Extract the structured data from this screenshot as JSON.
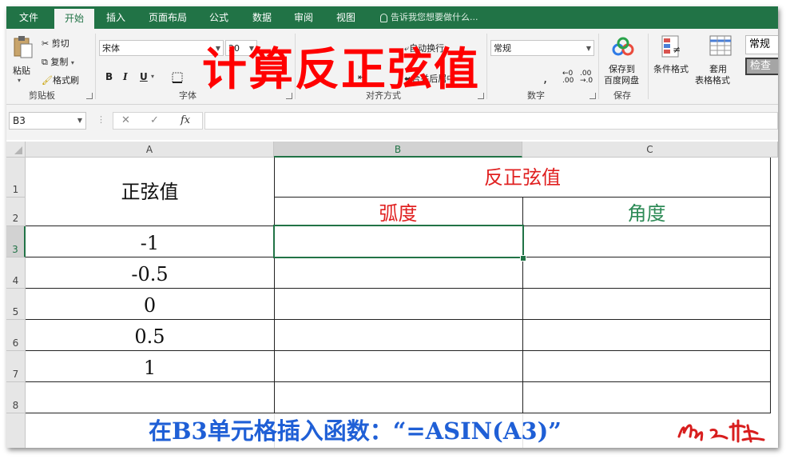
{
  "menu": {
    "file": "文件",
    "tabs": [
      "开始",
      "插入",
      "页面布局",
      "公式",
      "数据",
      "审阅",
      "视图"
    ],
    "active_tab": "开始",
    "tell_me": "告诉我您想要做什么..."
  },
  "ribbon": {
    "clipboard": {
      "paste": "粘贴",
      "cut": "剪切",
      "copy": "复制",
      "format_painter": "格式刷",
      "label": "剪贴板"
    },
    "font": {
      "name": "宋体",
      "size": "20",
      "bold": "B",
      "italic": "I",
      "underline": "U",
      "label": "字体"
    },
    "alignment": {
      "wrap": "自动换行",
      "merge": "合并后居中",
      "label": "对齐方式"
    },
    "number": {
      "format": "常规",
      "label": "数字"
    },
    "save": {
      "button": "保存到\n百度网盘",
      "line1": "保存到",
      "line2": "百度网盘",
      "label": "保存"
    },
    "styles": {
      "conditional": "条件格式",
      "table_line1": "套用",
      "table_line2": "表格格式",
      "style_normal": "常规",
      "style_check": "检查"
    }
  },
  "overlay_title": "计算反正弦值",
  "formula_bar": {
    "name_box": "B3",
    "cancel": "✕",
    "enter": "✓",
    "fx": "fx",
    "value": ""
  },
  "sheet": {
    "columns": [
      "A",
      "B",
      "C"
    ],
    "rows": [
      "1",
      "2",
      "3",
      "4",
      "5",
      "6",
      "7",
      "8"
    ],
    "selected_cell": "B3",
    "a_header": "正弦值",
    "merged_header": "反正弦值",
    "b_subheader": "弧度",
    "c_subheader": "角度",
    "a_values": [
      "-1",
      "-0.5",
      "0",
      "0.5",
      "1"
    ]
  },
  "caption": "在B3单元格插入函数：“=ASIN(A3)”",
  "colors": {
    "excel_green": "#217346",
    "red": "#ff0000",
    "cell_red": "#e02020",
    "cell_green": "#2e8b57",
    "caption_blue": "#1f5fd6"
  }
}
